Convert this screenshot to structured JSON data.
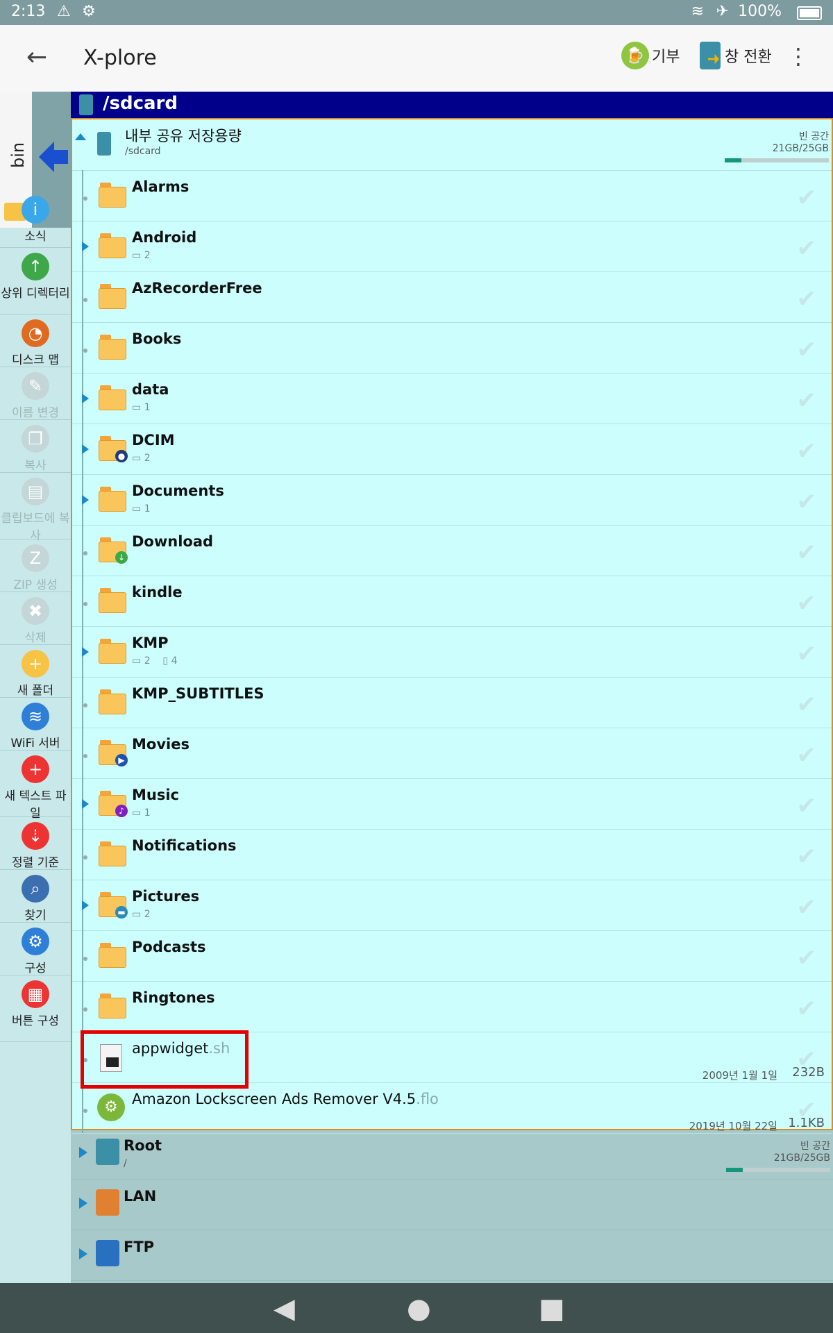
{
  "status": {
    "time": "2:13",
    "battery": "100%"
  },
  "appbar": {
    "back_icon": "arrow-left-icon",
    "title": "X-plore",
    "donate_label": "기부",
    "switch_label": "창 전환"
  },
  "sidebar": {
    "tab_label": "bin",
    "buttons": [
      {
        "label": "소식",
        "icon": "info-icon",
        "disabled": false
      },
      {
        "label": "상위 디렉터리",
        "icon": "up-arrow-icon",
        "disabled": false
      },
      {
        "label": "디스크 맵",
        "icon": "disk-map-icon",
        "disabled": false
      },
      {
        "label": "이름 변경",
        "icon": "rename-icon",
        "disabled": true
      },
      {
        "label": "복사",
        "icon": "copy-icon",
        "disabled": true
      },
      {
        "label": "클립보드에 복사",
        "icon": "clipboard-icon",
        "disabled": true
      },
      {
        "label": "ZIP 생성",
        "icon": "zip-icon",
        "disabled": true
      },
      {
        "label": "삭제",
        "icon": "trash-icon",
        "disabled": true
      },
      {
        "label": "새 폴더",
        "icon": "new-folder-icon",
        "disabled": false
      },
      {
        "label": "WiFi 서버",
        "icon": "wifi-icon",
        "disabled": false
      },
      {
        "label": "새 텍스트 파일",
        "icon": "new-text-file-icon",
        "disabled": false
      },
      {
        "label": "정렬 기준",
        "icon": "sort-icon",
        "disabled": false
      },
      {
        "label": "찾기",
        "icon": "search-icon",
        "disabled": false
      },
      {
        "label": "구성",
        "icon": "gear-icon",
        "disabled": false
      },
      {
        "label": "버튼 구성",
        "icon": "button-config-icon",
        "disabled": false
      }
    ]
  },
  "path": "/sdcard",
  "storage": {
    "name": "내부 공유 저장용량",
    "path": "/sdcard",
    "free_label": "빈 공간",
    "free_value": "21GB/25GB"
  },
  "folders": [
    {
      "name": "Alarms",
      "sub": "",
      "expandable": false
    },
    {
      "name": "Android",
      "sub": "2",
      "expandable": true
    },
    {
      "name": "AzRecorderFree",
      "sub": "",
      "expandable": false
    },
    {
      "name": "Books",
      "sub": "",
      "expandable": false
    },
    {
      "name": "data",
      "sub": "1",
      "expandable": true
    },
    {
      "name": "DCIM",
      "sub": "2",
      "expandable": true
    },
    {
      "name": "Documents",
      "sub": "1",
      "expandable": true
    },
    {
      "name": "Download",
      "sub": "",
      "expandable": false
    },
    {
      "name": "kindle",
      "sub": "",
      "expandable": false
    },
    {
      "name": "KMP",
      "sub": "2",
      "sub2": "4",
      "expandable": true
    },
    {
      "name": "KMP_SUBTITLES",
      "sub": "",
      "expandable": false
    },
    {
      "name": "Movies",
      "sub": "",
      "expandable": false
    },
    {
      "name": "Music",
      "sub": "1",
      "expandable": true
    },
    {
      "name": "Notifications",
      "sub": "",
      "expandable": false
    },
    {
      "name": "Pictures",
      "sub": "2",
      "expandable": true
    },
    {
      "name": "Podcasts",
      "sub": "",
      "expandable": false
    },
    {
      "name": "Ringtones",
      "sub": "",
      "expandable": false
    }
  ],
  "files": [
    {
      "name": "appwidget",
      "ext": ".sh",
      "date": "2009년 1월 1일",
      "size": "232B"
    },
    {
      "name": "Amazon Lockscreen Ads Remover V4.5",
      "ext": ".flo",
      "date": "2019년 10월 22일",
      "size": "1.1KB"
    }
  ],
  "lower": [
    {
      "name": "Root",
      "sub": "/",
      "free_label": "빈 공간",
      "free_value": "21GB/25GB"
    },
    {
      "name": "LAN",
      "sub": ""
    },
    {
      "name": "FTP",
      "sub": ""
    }
  ]
}
